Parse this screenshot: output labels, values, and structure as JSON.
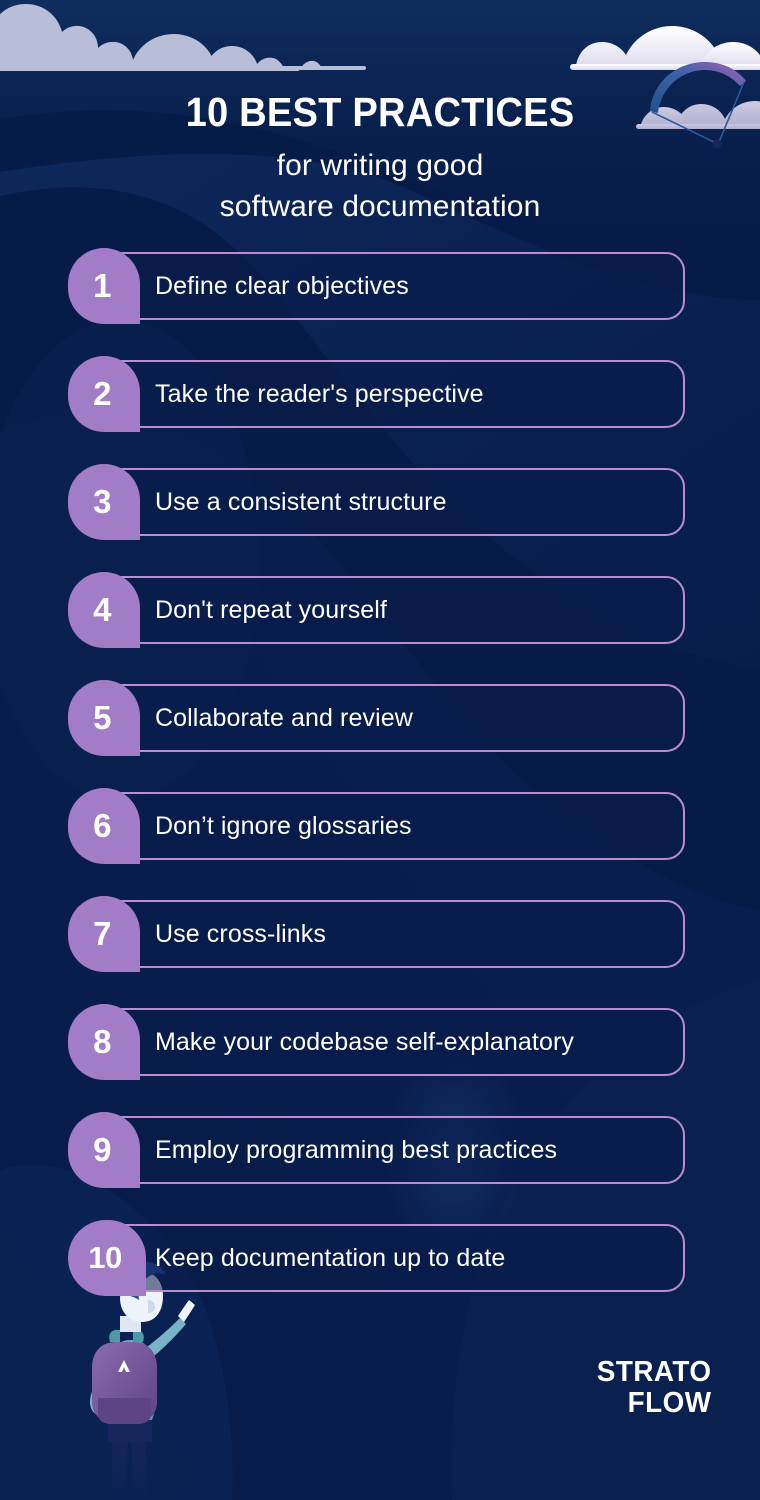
{
  "header": {
    "title": "10 BEST PRACTICES",
    "subtitle_line1": "for writing good",
    "subtitle_line2": "software documentation"
  },
  "practices": [
    {
      "number": "1",
      "label": "Define clear objectives"
    },
    {
      "number": "2",
      "label": "Take the reader's perspective"
    },
    {
      "number": "3",
      "label": "Use a consistent structure"
    },
    {
      "number": "4",
      "label": "Don't repeat yourself"
    },
    {
      "number": "5",
      "label": "Collaborate and review"
    },
    {
      "number": "6",
      "label": "Don’t ignore glossaries"
    },
    {
      "number": "7",
      "label": "Use cross-links"
    },
    {
      "number": "8",
      "label": "Make your codebase self-explanatory"
    },
    {
      "number": "9",
      "label": "Employ programming best practices"
    },
    {
      "number": "10",
      "label": "Keep documentation up to date"
    }
  ],
  "logo": {
    "line1": "STRATO",
    "line2": "FLOW"
  },
  "colors": {
    "background": "#071b48",
    "badge_purple": "#a37cc8",
    "pill_border": "#b98ed0",
    "text_white": "#ffffff",
    "cloud_lavender": "#b9bed8",
    "cloud_white": "#f4f2fb",
    "glider_blue": "#2f63a8",
    "glider_purple": "#9a5fb0",
    "hiker_hair": "#27519c",
    "hiker_shirt": "#6fb0c4",
    "hiker_backpack": "#7b5ea0",
    "hiker_pants": "#16255c"
  }
}
